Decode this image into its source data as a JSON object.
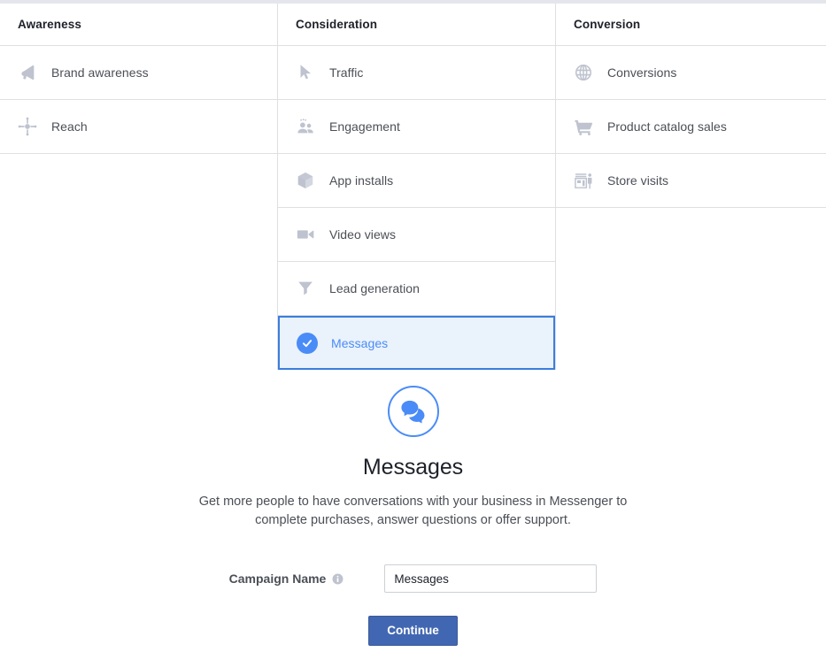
{
  "colors": {
    "accent_blue": "#4a8cf7",
    "selected_border": "#3b7ddd",
    "selected_bg": "#eaf2fb",
    "button_blue": "#4267b2",
    "icon_gray": "#bec3cf",
    "label_gray": "#4b4f56",
    "heading_dark": "#1d2129",
    "divider": "#dddfe2"
  },
  "columns": [
    {
      "header": "Awareness",
      "options": [
        {
          "label": "Brand awareness",
          "icon": "megaphone-icon",
          "selected": false
        },
        {
          "label": "Reach",
          "icon": "reach-burst-icon",
          "selected": false
        }
      ]
    },
    {
      "header": "Consideration",
      "options": [
        {
          "label": "Traffic",
          "icon": "cursor-arrow-icon",
          "selected": false
        },
        {
          "label": "Engagement",
          "icon": "people-icon",
          "selected": false
        },
        {
          "label": "App installs",
          "icon": "box-icon",
          "selected": false
        },
        {
          "label": "Video views",
          "icon": "video-camera-icon",
          "selected": false
        },
        {
          "label": "Lead generation",
          "icon": "funnel-icon",
          "selected": false
        },
        {
          "label": "Messages",
          "icon": "check-circle-icon",
          "selected": true
        }
      ]
    },
    {
      "header": "Conversion",
      "options": [
        {
          "label": "Conversions",
          "icon": "globe-icon",
          "selected": false
        },
        {
          "label": "Product catalog sales",
          "icon": "shopping-cart-icon",
          "selected": false
        },
        {
          "label": "Store visits",
          "icon": "storefront-icon",
          "selected": false
        }
      ]
    }
  ],
  "detail": {
    "icon": "chat-bubbles-icon",
    "title": "Messages",
    "description": "Get more people to have conversations with your business in Messenger to complete purchases, answer questions or offer support."
  },
  "form": {
    "campaign_name_label": "Campaign Name",
    "info_icon": "info-icon",
    "campaign_name_value": "Messages",
    "campaign_name_placeholder": "Campaign Name"
  },
  "actions": {
    "continue_label": "Continue"
  }
}
